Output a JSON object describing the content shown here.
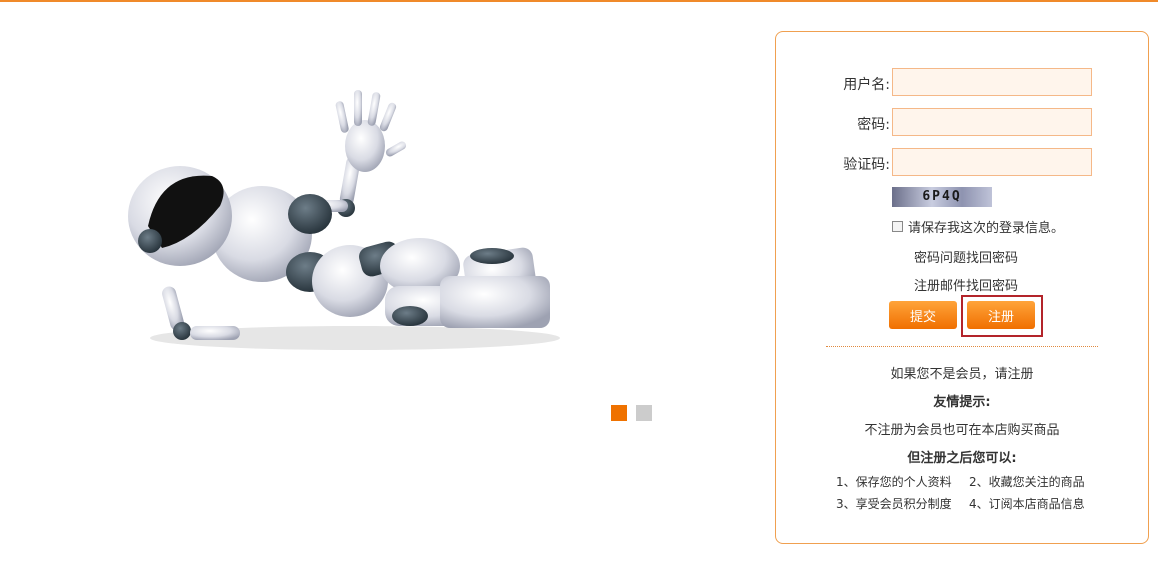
{
  "accent_color": "#f08a2a",
  "carousel": {
    "image_alt": "robot",
    "dots": [
      "active",
      "inactive"
    ]
  },
  "login": {
    "username_label": "用户名:",
    "password_label": "密码:",
    "captcha_label": "验证码:",
    "username_value": "",
    "password_value": "",
    "captcha_value": "",
    "captcha_text": "6P4Q",
    "remember_label": "请保存我这次的登录信息。",
    "recover_question_link": "密码问题找回密码",
    "recover_email_link": "注册邮件找回密码",
    "submit_label": "提交",
    "register_label": "注册"
  },
  "info": {
    "not_member": "如果您不是会员，请注册",
    "tip_title": "友情提示:",
    "tip_text": "不注册为会员也可在本店购买商品",
    "after_title": "但注册之后您可以:",
    "benefits": [
      "1、保存您的个人资料",
      "2、收藏您关注的商品",
      "3、享受会员积分制度",
      "4、订阅本店商品信息"
    ]
  }
}
